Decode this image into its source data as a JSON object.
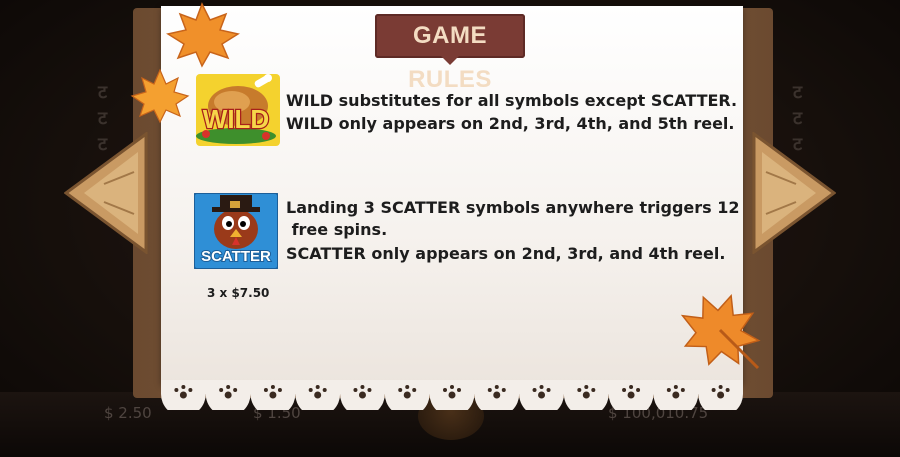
{
  "dialog": {
    "title": "GAME RULES"
  },
  "rules": [
    {
      "symbol": "WILD",
      "icon": "roast-turkey-wild-icon",
      "lines": [
        "WILD substitutes for all symbols except SCATTER.",
        "WILD only appears on 2nd, 3rd, 4th, and 5th reel."
      ]
    },
    {
      "symbol": "SCATTER",
      "icon": "pilgrim-turkey-scatter-icon",
      "payout": "3 x $7.50",
      "lines": [
        "Landing 3 SCATTER symbols anywhere triggers 12",
        " free spins.",
        "SCATTER only appears on 2nd, 3rd, and 4th reel."
      ]
    }
  ],
  "navigation": {
    "prev_icon": "wooden-arrow-left-icon",
    "next_icon": "wooden-arrow-right-icon"
  },
  "background_bar": {
    "balance": "$ 2.50",
    "bet": "$ 1.50",
    "win": "$ 100,010.75"
  },
  "colors": {
    "banner": "#7a3b34",
    "banner_text": "#f3dcc2",
    "wood": "#c99a63",
    "leaf": "#e8892a"
  }
}
